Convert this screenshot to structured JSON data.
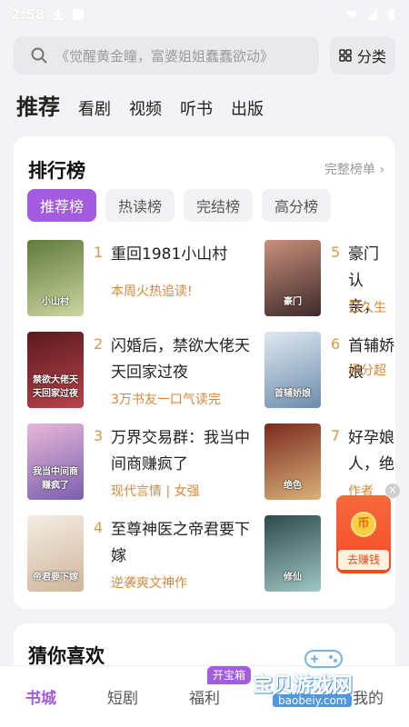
{
  "status": {
    "time": "2:58"
  },
  "search": {
    "placeholder": "《觉醒黄金瞳，富婆姐姐蠢蠢欲动》"
  },
  "category_label": "分类",
  "top_tabs": [
    "推荐",
    "看剧",
    "视频",
    "听书",
    "出版"
  ],
  "ranking": {
    "title": "排行榜",
    "more": "完整榜单",
    "pills": [
      "推荐榜",
      "热读榜",
      "完结榜",
      "高分榜"
    ],
    "books": [
      {
        "rank": "1",
        "title": "重回1981小山村",
        "tag": "本周火热追读!",
        "cover_text": "小山村",
        "cover_colors": [
          "#5f7b3a",
          "#cdd6a0"
        ]
      },
      {
        "rank": "2",
        "title": "闪婚后，禁欲大佬天天回家过夜",
        "tag": "3万书友一口气读完",
        "cover_text": "禁欲大佬天天回家过夜",
        "cover_colors": [
          "#5a1a1f",
          "#b8434a"
        ]
      },
      {
        "rank": "3",
        "title": "万界交易群：我当中间商赚疯了",
        "tag": "现代言情 | 女强",
        "cover_text": "我当中间商赚疯了",
        "cover_colors": [
          "#e7b7d6",
          "#7a5fb0"
        ]
      },
      {
        "rank": "4",
        "title": "至尊神医之帝君要下嫁",
        "tag": "逆袭爽文神作",
        "cover_text": "帝君要下嫁",
        "cover_colors": [
          "#f4ede4",
          "#cfb59a"
        ]
      },
      {
        "rank": "5",
        "title": "豪门认亲，真千金",
        "tag": "日久生",
        "cover_text": "豪门",
        "cover_colors": [
          "#c98f7a",
          "#3e2a2a"
        ]
      },
      {
        "rank": "6",
        "title": "首辅娇娘",
        "tag": "评分超",
        "cover_text": "首辅娇娘",
        "cover_colors": [
          "#dfe8f0",
          "#6b8cac"
        ]
      },
      {
        "rank": "7",
        "title": "好孕娘人，绝",
        "tag": "作者",
        "cover_text": "绝色",
        "cover_colors": [
          "#7a2a1e",
          "#d9b27a"
        ]
      },
      {
        "rank": "8",
        "title": "",
        "tag": "",
        "cover_text": "修仙",
        "cover_colors": [
          "#2e4a4a",
          "#9fc7c4"
        ]
      }
    ]
  },
  "reward": {
    "label": "去赚钱",
    "coin": "币"
  },
  "guess": {
    "title": "猜你喜欢"
  },
  "bottom_nav": {
    "items": [
      "书城",
      "短剧",
      "福利",
      "",
      "我的"
    ],
    "badge": "开宝箱"
  },
  "watermark": {
    "text": "宝贝游戏网",
    "url": "baobeiy.com"
  }
}
